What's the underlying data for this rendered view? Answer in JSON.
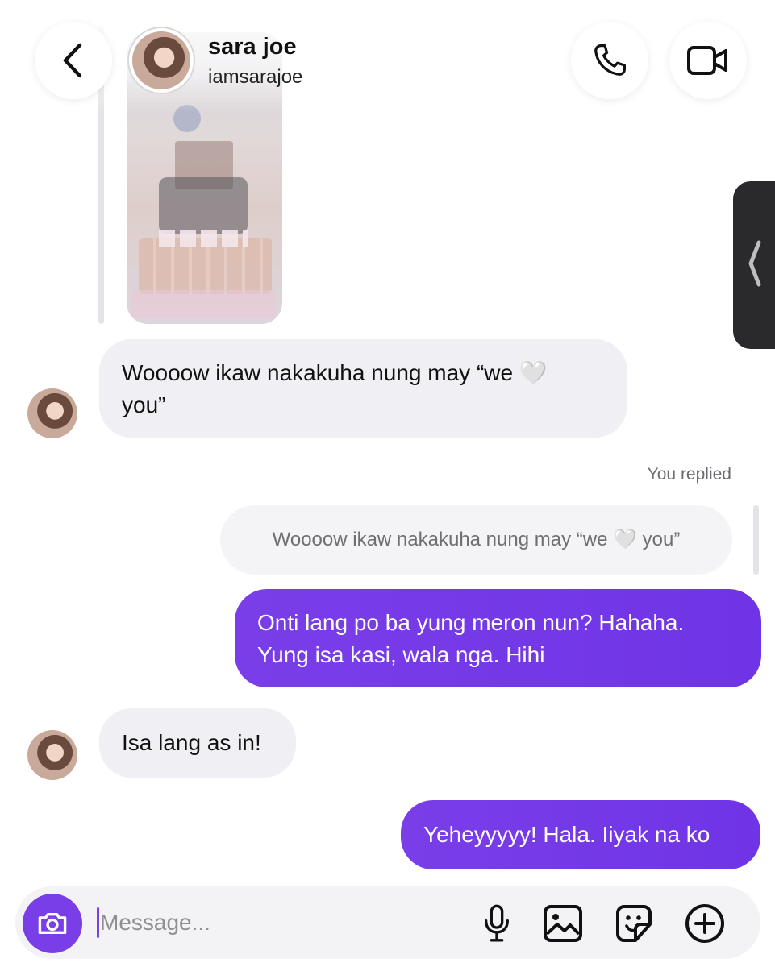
{
  "header": {
    "name": "sara joe",
    "handle": "iamsarajoe",
    "icons": {
      "back": "chevron-left-icon",
      "call": "phone-icon",
      "video": "video-camera-icon"
    }
  },
  "thread": {
    "msg1": {
      "line1": "Woooow ikaw nakakuha nung may “we ",
      "heart": "🤍",
      "line2": "you”"
    },
    "replied_label": "You replied",
    "quote": {
      "before": "Woooow ikaw nakakuha nung may “we ",
      "heart": "🤍",
      "after": " you”"
    },
    "msg2": {
      "line1": "Onti lang po ba yung meron nun? Hahaha.",
      "line2": "Yung isa kasi, wala nga. Hihi"
    },
    "msg3": "Isa lang as in!",
    "msg4": "Yeheyyyyy! Hala. Iiyak na ko"
  },
  "composer": {
    "placeholder": "Message...",
    "icons": [
      "camera-icon",
      "microphone-icon",
      "gallery-icon",
      "sticker-icon",
      "plus-icon"
    ]
  },
  "colors": {
    "accent": "#7a3ee8",
    "incoming_bubble": "#efeff4"
  }
}
